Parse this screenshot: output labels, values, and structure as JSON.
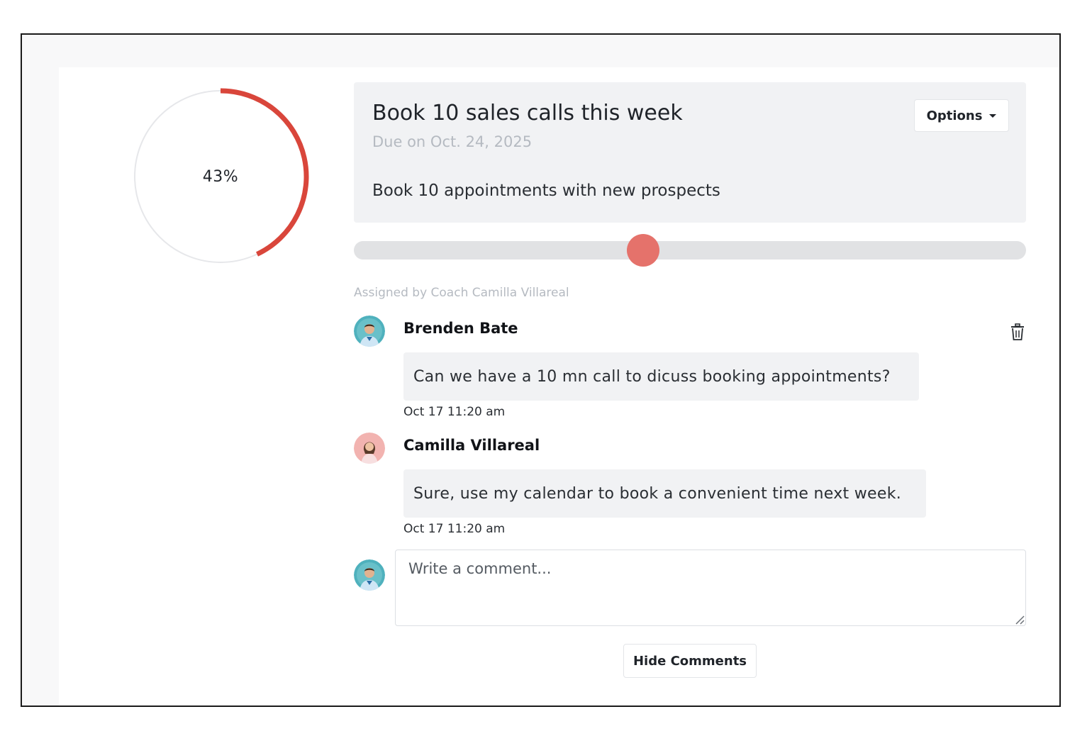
{
  "progress": {
    "percent": 43,
    "label": "43%",
    "color": "#d9463b",
    "track_color": "#e6e7ea"
  },
  "goal": {
    "title": "Book 10 sales calls this week",
    "due": "Due on Oct. 24, 2025",
    "description": "Book 10 appointments with new prospects",
    "options_label": "Options"
  },
  "slider": {
    "value_percent": 43,
    "thumb_color": "#e5726b"
  },
  "assigned_text": "Assigned by Coach Camilla Villareal",
  "comments": [
    {
      "author": "Brenden Bate",
      "text": "Can we have a 10 mn call to dicuss booking appointments?",
      "time": "Oct 17 11:20 am",
      "avatar": "male-avatar"
    },
    {
      "author": "Camilla Villareal",
      "text": "Sure, use my calendar to book a convenient time next week.",
      "time": "Oct 17 11:20 am",
      "avatar": "female-avatar"
    }
  ],
  "comment_input": {
    "placeholder": "Write a comment...",
    "value": ""
  },
  "hide_comments_label": "Hide Comments",
  "icons": {
    "delete": "trash-icon",
    "options": "chevron-down-icon"
  }
}
